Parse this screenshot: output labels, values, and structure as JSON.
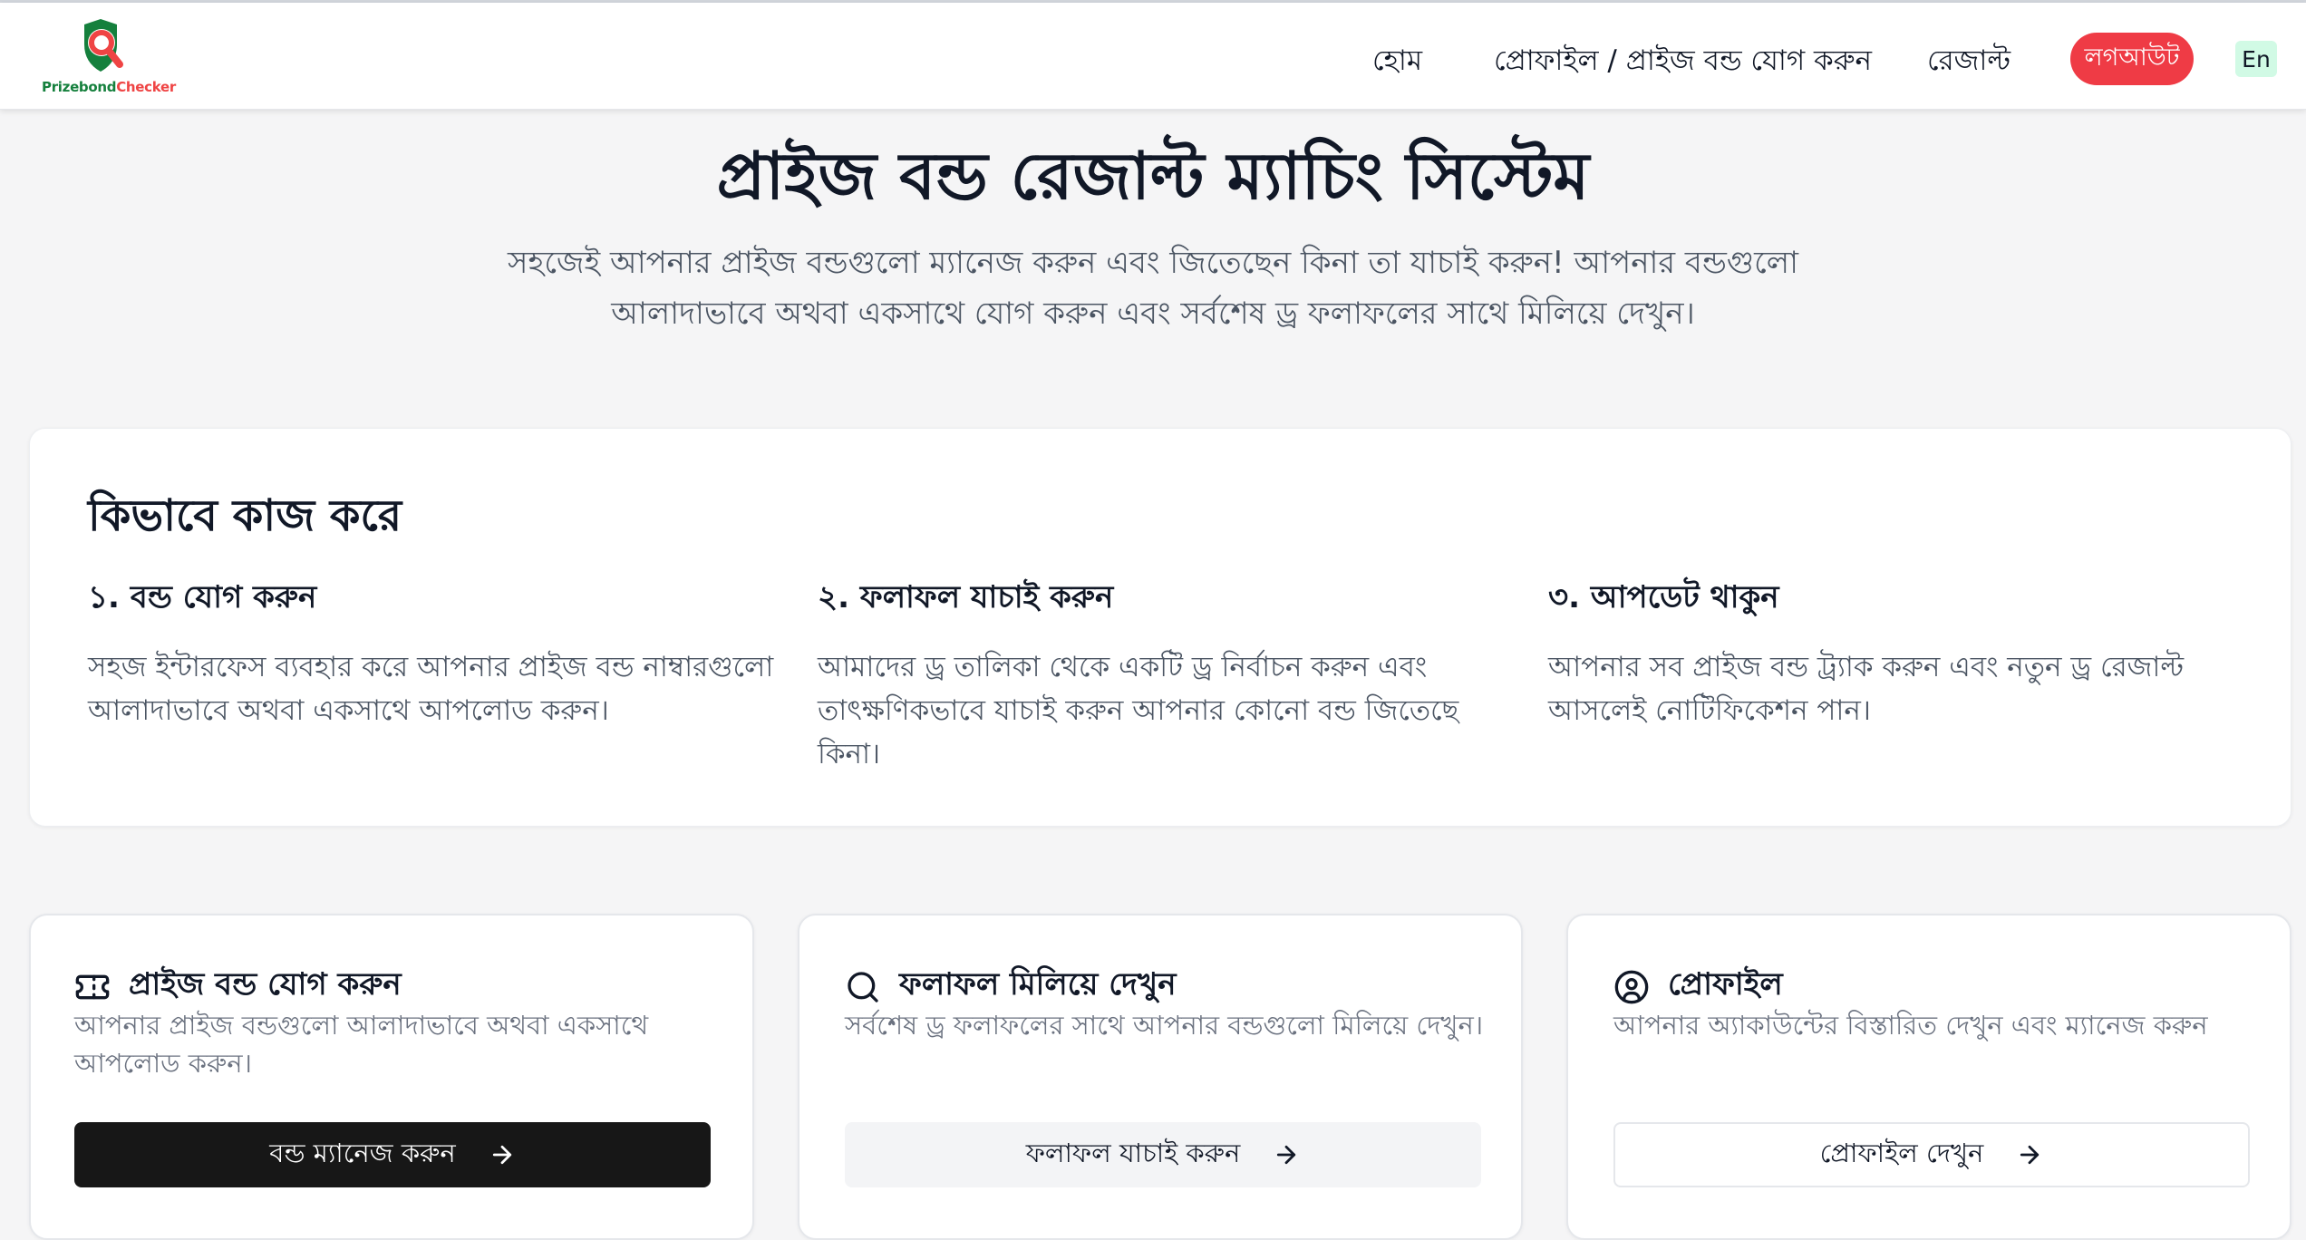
{
  "brand": {
    "name_part1": "Prizebond",
    "name_part2": "Checker",
    "colors": {
      "green": "#15803d",
      "red": "#ef4444"
    }
  },
  "nav": {
    "home": "হোম",
    "profile": "প্রোফাইল / প্রাইজ বন্ড যোগ করুন",
    "results": "রেজাল্ট",
    "logout": "লগআউট",
    "language": "En"
  },
  "hero": {
    "title": "প্রাইজ বন্ড রেজাল্ট ম্যাচিং সিস্টেম",
    "subtitle": "সহজেই আপনার প্রাইজ বন্ডগুলো ম্যানেজ করুন এবং জিতেছেন কিনা তা যাচাই করুন! আপনার বন্ডগুলো আলাদাভাবে অথবা একসাথে যোগ করুন এবং সর্বশেষ ড্র ফলাফলের সাথে মিলিয়ে দেখুন।"
  },
  "how_it_works": {
    "title": "কিভাবে কাজ করে",
    "steps": [
      {
        "title": "১. বন্ড যোগ করুন",
        "desc": "সহজ ইন্টারফেস ব্যবহার করে আপনার প্রাইজ বন্ড নাম্বারগুলো আলাদাভাবে অথবা একসাথে আপলোড করুন।"
      },
      {
        "title": "২. ফলাফল যাচাই করুন",
        "desc": "আমাদের ড্র তালিকা থেকে একটি ড্র নির্বাচন করুন এবং তাৎক্ষণিকভাবে যাচাই করুন আপনার কোনো বন্ড জিতেছে কিনা।"
      },
      {
        "title": "৩. আপডেট থাকুন",
        "desc": "আপনার সব প্রাইজ বন্ড ট্র্যাক করুন এবং নতুন ড্র রেজাল্ট আসলেই নোটিফিকেশন পান।"
      }
    ]
  },
  "cards": [
    {
      "icon": "ticket-icon",
      "title": "প্রাইজ বন্ড যোগ করুন",
      "desc": "আপনার প্রাইজ বন্ডগুলো আলাদাভাবে অথবা একসাথে আপলোড করুন।",
      "button": "বন্ড ম্যানেজ করুন"
    },
    {
      "icon": "search-icon",
      "title": "ফলাফল মিলিয়ে দেখুন",
      "desc": "সর্বশেষ ড্র ফলাফলের সাথে আপনার বন্ডগুলো মিলিয়ে দেখুন।",
      "button": "ফলাফল যাচাই করুন"
    },
    {
      "icon": "user-circle-icon",
      "title": "প্রোফাইল",
      "desc": "আপনার অ্যাকাউন্টের বিস্তারিত দেখুন এবং ম্যানেজ করুন",
      "button": "প্রোফাইল দেখুন"
    }
  ]
}
